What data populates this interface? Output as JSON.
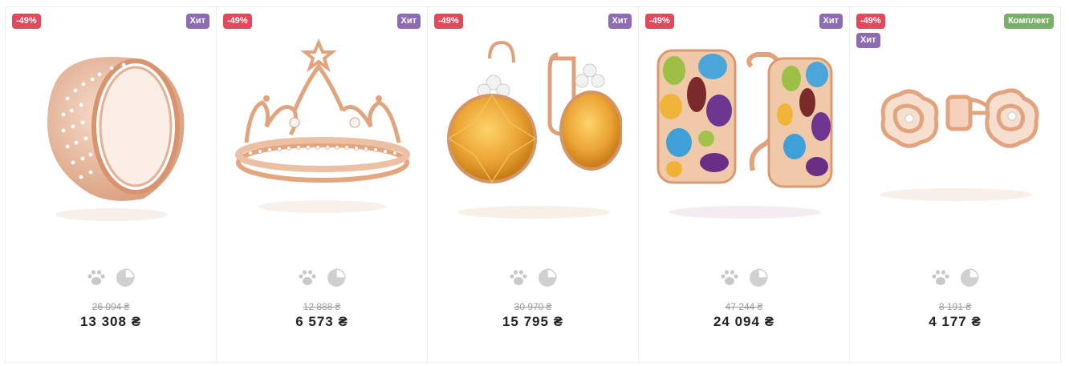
{
  "products": [
    {
      "discount_badge": "-49%",
      "label_badge": "Хит",
      "old_price": "26 094 ₴",
      "price": "13 308 ₴",
      "image_icon": "wide-ring-icon",
      "feature_icons": [
        "paw-icon",
        "pie-icon"
      ]
    },
    {
      "discount_badge": "-49%",
      "label_badge": "Хит",
      "old_price": "12 888 ₴",
      "price": "6 573 ₴",
      "image_icon": "crown-ring-icon",
      "feature_icons": [
        "paw-icon",
        "pie-icon"
      ]
    },
    {
      "discount_badge": "-49%",
      "label_badge": "Хит",
      "old_price": "30 970 ₴",
      "price": "15 795 ₴",
      "image_icon": "citrine-earrings-icon",
      "feature_icons": [
        "paw-icon",
        "pie-icon"
      ]
    },
    {
      "discount_badge": "-49%",
      "label_badge": "Хит",
      "old_price": "47 244 ₴",
      "price": "24 094 ₴",
      "image_icon": "multi-gem-earrings-icon",
      "feature_icons": [
        "paw-icon",
        "pie-icon"
      ]
    },
    {
      "discount_badge": "-49%",
      "label_badge": "Хит",
      "kit_badge": "Комплект",
      "old_price": "8 191 ₴",
      "price": "4 177 ₴",
      "image_icon": "rose-stud-earrings-icon",
      "feature_icons": [
        "paw-icon",
        "pie-icon"
      ]
    }
  ],
  "colors": {
    "discount": "#e5485b",
    "hit": "#8e6cb3",
    "kit": "#7aaf6a",
    "gold": "#e8b48f",
    "icon_gray": "#c8c8c8"
  }
}
